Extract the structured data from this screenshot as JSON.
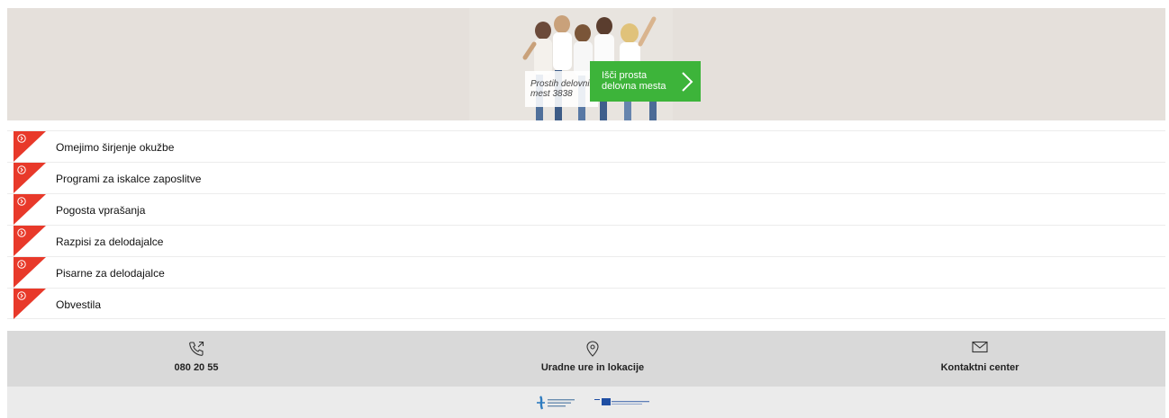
{
  "hero": {
    "count_line1": "Prostih delovnih",
    "count_line2": "mest 3838",
    "button_line1": "Išči prosta",
    "button_line2": "delovna mesta"
  },
  "menu": {
    "items": [
      {
        "label": "Omejimo širjenje okužbe"
      },
      {
        "label": "Programi za iskalce zaposlitve"
      },
      {
        "label": "Pogosta vprašanja"
      },
      {
        "label": "Razpisi za delodajalce"
      },
      {
        "label": "Pisarne za delodajalce"
      },
      {
        "label": "Obvestila"
      }
    ]
  },
  "footer": {
    "phone": {
      "icon": "phone-icon",
      "label": "080 20 55"
    },
    "locations": {
      "icon": "location-pin-icon",
      "label": "Uradne ure in lokacije"
    },
    "contact": {
      "icon": "envelope-icon",
      "label": "Kontaktni center"
    }
  },
  "colors": {
    "accent_red": "#e8392a",
    "accent_green": "#3db43a",
    "hero_bg": "#e5e0db",
    "footer_bg": "#d9d9d9",
    "logos_bg": "#ebebeb"
  }
}
